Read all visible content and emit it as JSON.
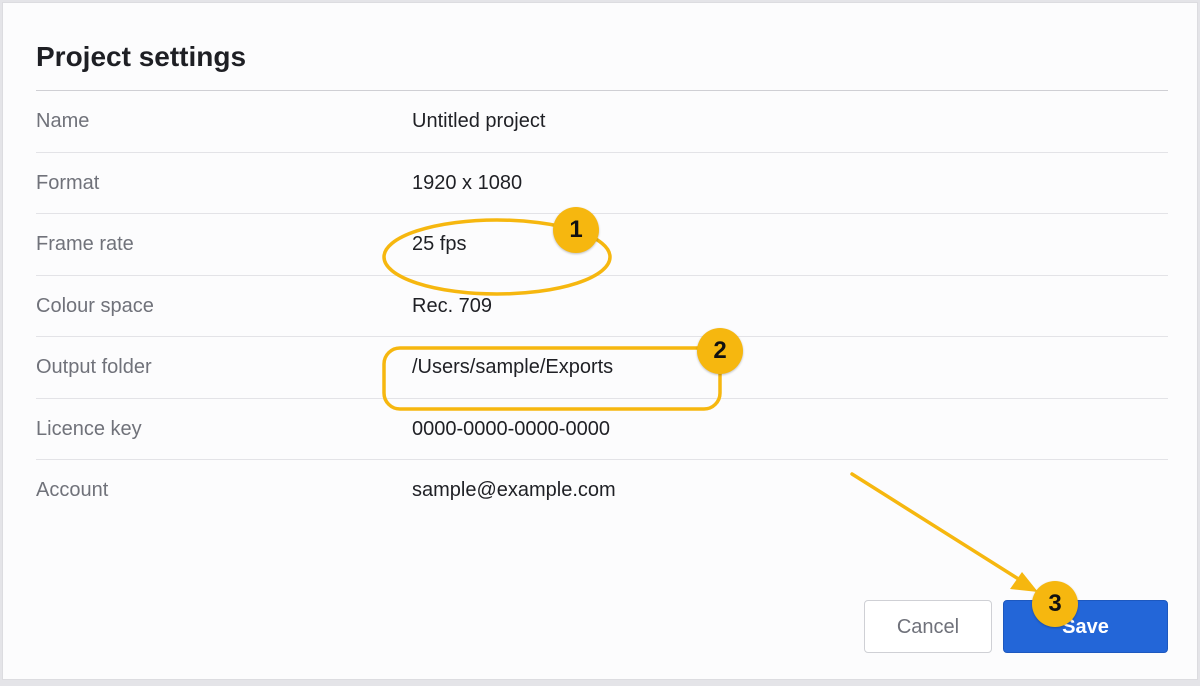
{
  "dialog": {
    "title": "Project settings",
    "rows": [
      {
        "label": "Name",
        "value": "Untitled project"
      },
      {
        "label": "Format",
        "value": "1920 x 1080"
      },
      {
        "label": "Frame rate",
        "value": "25 fps"
      },
      {
        "label": "Colour space",
        "value": "Rec. 709"
      },
      {
        "label": "Output folder",
        "value": "/Users/sample/Exports"
      },
      {
        "label": "Licence key",
        "value": "0000-0000-0000-0000"
      },
      {
        "label": "Account",
        "value": "sample@example.com"
      }
    ],
    "buttons": {
      "cancel_label": "Cancel",
      "save_label": "Save"
    }
  },
  "annotations": {
    "badges": [
      "1",
      "2",
      "3"
    ],
    "color": "#f6b70f"
  },
  "colors": {
    "primary": "#2366d8",
    "annotation": "#f6b70f"
  }
}
